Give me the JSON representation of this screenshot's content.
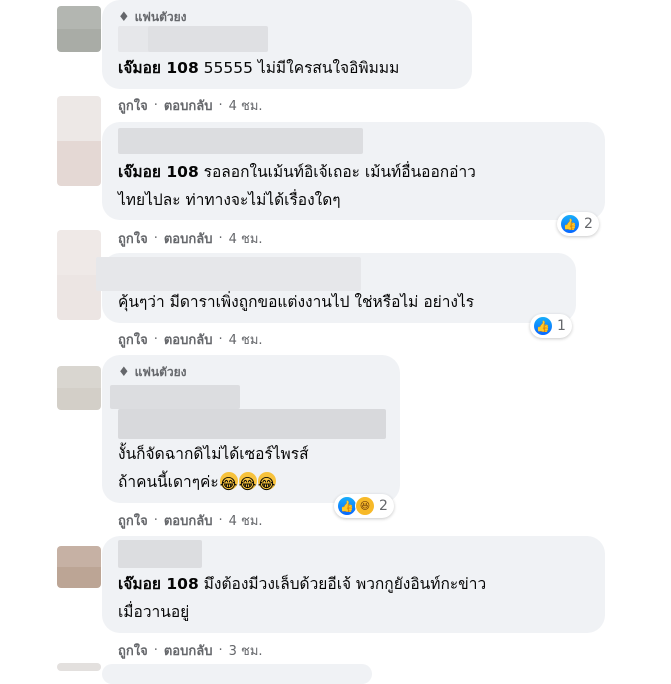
{
  "fan_badge": "แฟนตัวยง",
  "like_label": "ถูกใจ",
  "reply_label": "ตอบกลับ",
  "separator": "·",
  "comments": [
    {
      "author": "เจ๊มอย 108",
      "text": " 55555 ไม่มีใครสนใจอิพิมมม",
      "time": "4 ชม."
    },
    {
      "author": "เจ๊มอย 108",
      "text": " รอลอกในเม้นท์อิเจ้เถอะ เม้นท์อื่นออกอ่าว\nไทยไปละ ท่าทางจะไม่ได้เรื่องใดๆ",
      "time": "4 ชม.",
      "reaction_count": "2"
    },
    {
      "text": "คุ้นๆว่า มีดาราเพิ่งถูกขอแต่งงานไป ใช่หรือไม่ อย่างไร",
      "time": "4 ชม.",
      "reaction_count": "1"
    },
    {
      "text_line1": "งั้นก็จัดฉากดิไม่ได้เซอร์ไพรส์",
      "text_line2": "ถ้าคนนี้เดาๆค่ะ",
      "time": "4 ชม.",
      "reaction_count": "2"
    },
    {
      "author": "เจ๊มอย 108",
      "text": " มึงต้องมีวงเล็บด้วยอีเจ้ พวกกูยังอินท์กะข่าว\nเมื่อวานอยู่",
      "time": "3 ชม."
    }
  ],
  "icons": {
    "like": "like-icon",
    "haha": "haha-icon",
    "fan": "diamond-icon"
  },
  "colors": {
    "bubble": "#f0f2f5",
    "meta_text": "#65676b",
    "like_blue": "#0866ff"
  }
}
